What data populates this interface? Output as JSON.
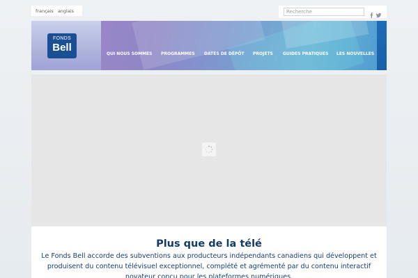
{
  "languages": [
    {
      "label": "français"
    },
    {
      "label": "anglais"
    }
  ],
  "search": {
    "placeholder": "Recherche"
  },
  "social": [
    {
      "icon": "facebook-icon",
      "glyph": "f"
    },
    {
      "icon": "twitter-icon"
    }
  ],
  "logo": {
    "line1": "FONDS",
    "line2": "Bell",
    "color": "#1a4f93"
  },
  "nav": [
    {
      "label": "QUI NOUS SOMMES"
    },
    {
      "label": "PROGRAMMES"
    },
    {
      "label": "DATES DE DÉPÔT"
    },
    {
      "label": "PROJETS"
    },
    {
      "label": "GUIDES PRATIQUES"
    },
    {
      "label": "LES NOUVELLES"
    }
  ],
  "slideshow": {
    "state": "loading"
  },
  "content": {
    "title": "Plus que de la télé",
    "description": "Le Fonds Bell accorde des subventions aux producteurs indépendants canadiens qui développent et produisent du contenu télévisuel exceptionnel, complété et agrémenté par du contenu interactif novateur conçu pour les plateformes numériques."
  },
  "colors": {
    "title": "#123a6b",
    "body_text": "#163e6e",
    "nav_text": "#ffffff"
  }
}
